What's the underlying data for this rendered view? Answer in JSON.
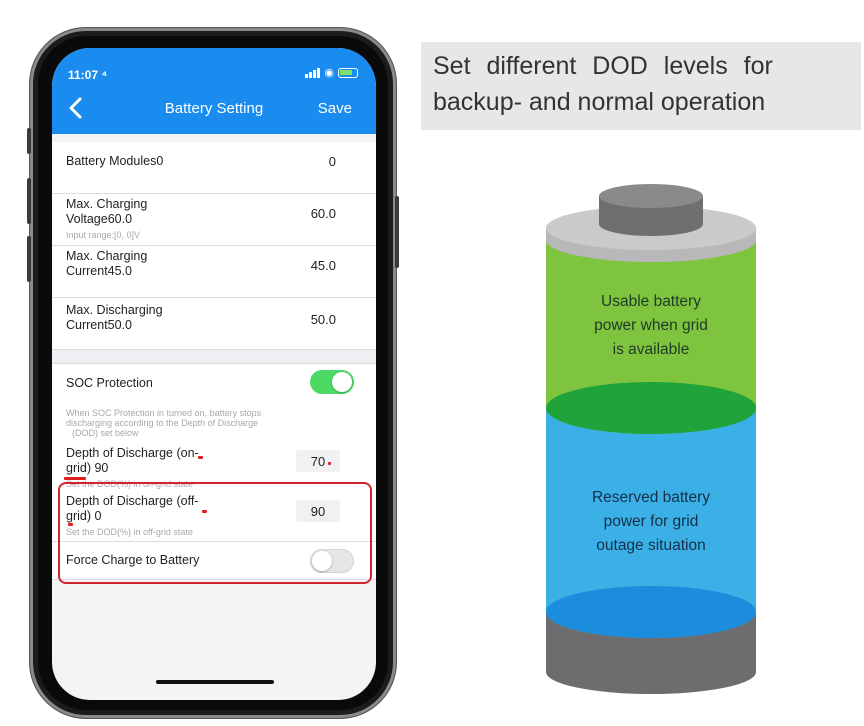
{
  "status_bar": {
    "time": "11:07 ⁴"
  },
  "nav": {
    "title": "Battery Setting",
    "save_label": "Save"
  },
  "rows": {
    "modules": {
      "label": "Battery Modules0",
      "value": "0"
    },
    "charge_voltage": {
      "label_line1": "Max. Charging",
      "label_line2": "Voltage60.0",
      "value": "60.0",
      "hint": "Input range:[0,  0]V"
    },
    "charge_current": {
      "label_line1": "Max. Charging",
      "label_line2": "Current45.0",
      "value": "45.0"
    },
    "discharge_current": {
      "label_line1": "Max. Discharging",
      "label_line2": "Current50.0",
      "value": "50.0"
    },
    "soc_protection": {
      "label": "SOC Protection",
      "enabled": true,
      "desc_line1": "When SOC Protection in turned on,  battery stops",
      "desc_line2": "discharging according to the Depth of Discharge",
      "desc_line3": "(DOD)  set below"
    },
    "dod_on_grid": {
      "label_line1": "Depth of Discharge  (on-",
      "label_line2": "grid)  90",
      "value": "70",
      "hint": "Set the DOD(%) in on-grid state"
    },
    "dod_off_grid": {
      "label_line1": "Depth of Discharge  (off-",
      "label_line2": "grid)  0",
      "value": "90",
      "hint": "Set the DOD(%) in off-grid state"
    },
    "force_charge": {
      "label": "Force Charge to Battery",
      "enabled": false
    }
  },
  "caption": {
    "line1": "Set different DOD levels for",
    "line2": "backup- and normal operation"
  },
  "battery_graphic": {
    "usable_line1": "Usable battery",
    "usable_line2": "power when grid",
    "usable_line3": "is available",
    "reserved_line1": "Reserved battery",
    "reserved_line2": "power for grid",
    "reserved_line3": "outage situation"
  },
  "colors": {
    "nav_blue": "#1a8cf0",
    "toggle_on": "#4cd964",
    "highlight_red": "#d0252e",
    "usable_green": "#7ec43f",
    "reserved_blue": "#3bb0e6",
    "cap_gray": "#8a8a8c"
  },
  "icons": {
    "back": "chevron-left-icon",
    "signal": "signal-icon",
    "wifi": "wifi-icon",
    "battery": "battery-status-icon"
  }
}
